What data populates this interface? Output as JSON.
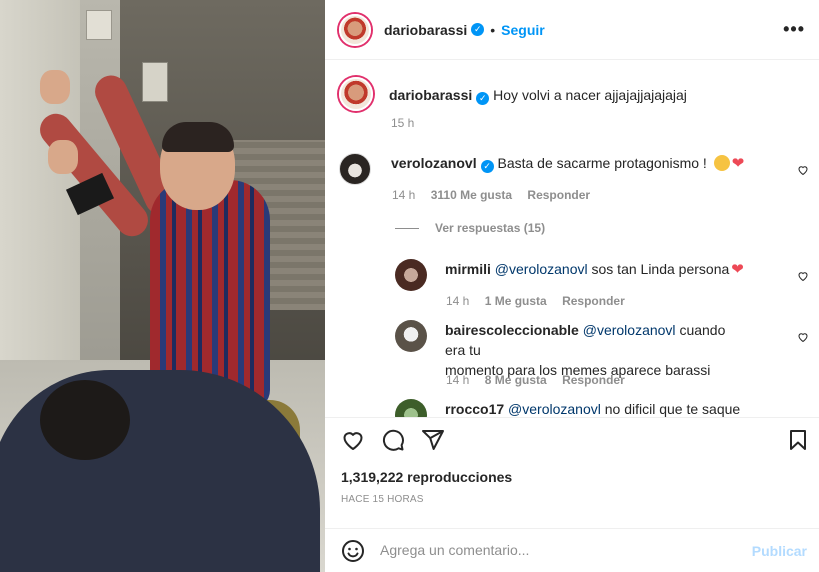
{
  "post": {
    "username": "dariobarassi",
    "follow_label": "Seguir",
    "more_label": "•••",
    "caption": "Hoy volvi a nacer ajjajajjajajajaj",
    "caption_time": "15 h"
  },
  "comments": [
    {
      "username": "verolozanovl",
      "verified": true,
      "text": "Basta de sacarme protagonismo !",
      "time": "14 h",
      "likes": "3110 Me gusta",
      "reply_label": "Responder"
    }
  ],
  "view_replies_label": "Ver respuestas (15)",
  "replies": [
    {
      "username": "mirmili",
      "mention": "@verolozanovl",
      "text": "sos tan Linda persona",
      "time": "14 h",
      "likes": "1 Me gusta",
      "reply_label": "Responder"
    },
    {
      "username": "bairescoleccionable",
      "mention": "@verolozanovl",
      "text": "cuando era tu",
      "text2": "momento para los memes aparece barassi",
      "time": "14 h",
      "likes": "8 Me gusta",
      "reply_label": "Responder"
    },
    {
      "username": "rrocco17",
      "mention": "@verolozanovl",
      "text": "no dificil que te saque"
    }
  ],
  "stats": {
    "views": "1,319,222 reproducciones",
    "posted_ago": "HACE 15 HORAS"
  },
  "comment_box": {
    "placeholder": "Agrega un comentario...",
    "publish_label": "Publicar"
  },
  "colors": {
    "accent": "#0095f6",
    "heart": "#ed4956",
    "muted": "#8e8e8e",
    "publish_disabled": "#b3dbff"
  },
  "icons": [
    "heart-icon",
    "comment-icon",
    "share-icon",
    "bookmark-icon",
    "emoji-icon",
    "verified-icon",
    "more-icon"
  ]
}
